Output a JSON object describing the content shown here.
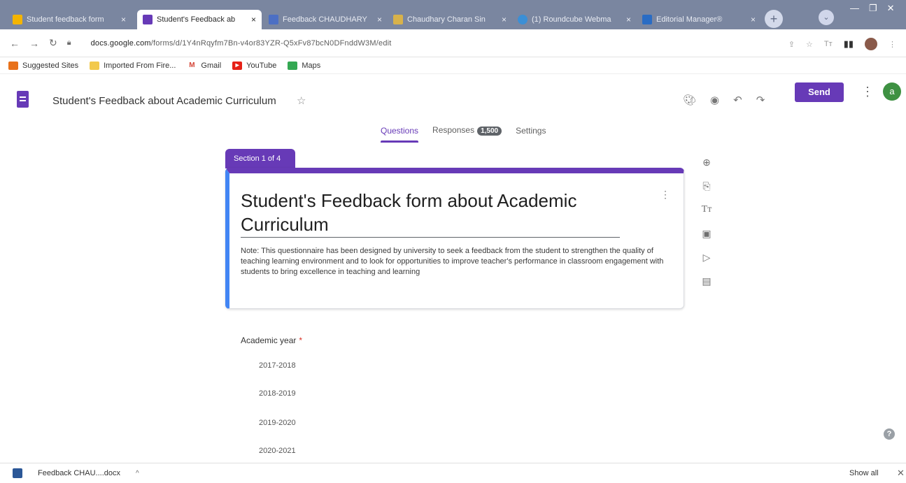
{
  "browser": {
    "tabs": [
      {
        "label": "Student feedback form",
        "active": false,
        "icon": "drive-icon",
        "color": "#f4b400"
      },
      {
        "label": "Student's Feedback ab",
        "active": true,
        "icon": "forms-icon",
        "color": "#673ab7"
      },
      {
        "label": "Feedback CHAUDHARY",
        "active": false,
        "icon": "forms-icon",
        "color": "#4c6fc4"
      },
      {
        "label": "Chaudhary Charan Sin",
        "active": false,
        "icon": "university-icon",
        "color": "#d8b24a"
      },
      {
        "label": "(1) Roundcube Webma",
        "active": false,
        "icon": "roundcube-icon",
        "color": "#3b8fd6"
      },
      {
        "label": "Editorial Manager®",
        "active": false,
        "icon": "editorial-icon",
        "color": "#2a6cc4"
      }
    ],
    "tab_close": "×",
    "new_tab": "+",
    "url_host": "docs.google.com",
    "url_path": "/forms/d/1Y4nRqyfm7Bn-v4or83YZR-Q5xFv87bcN0DFnddW3M/edit",
    "bookmarks": [
      {
        "label": "Suggested Sites",
        "icon": "bookmark-icon",
        "color": "#e8711a"
      },
      {
        "label": "Imported From Fire...",
        "icon": "folder-icon",
        "color": "#f2c94c"
      },
      {
        "label": "Gmail",
        "icon": "gmail-icon",
        "color": "#d44638"
      },
      {
        "label": "YouTube",
        "icon": "youtube-icon",
        "color": "#e62117"
      },
      {
        "label": "Maps",
        "icon": "maps-icon",
        "color": "#34a853"
      }
    ]
  },
  "forms_header": {
    "title": "Student's Feedback about Academic Curriculum",
    "send_label": "Send",
    "avatar_letter": "a",
    "accent": "#673ab7"
  },
  "form_tabs": {
    "questions": "Questions",
    "responses": "Responses",
    "responses_count": "1,500",
    "settings": "Settings"
  },
  "section": {
    "label": "Section 1 of 4",
    "title": "Student's Feedback form about Academic Curriculum",
    "note": "Note: This questionnaire has been designed by university to seek a feedback from the student to strengthen the quality of teaching learning environment and to look for opportunities to improve teacher's performance in classroom engagement with students to bring excellence in teaching and learning"
  },
  "question": {
    "label": "Academic year",
    "required_mark": "*",
    "options": [
      "2017-2018",
      "2018-2019",
      "2019-2020",
      "2020-2021"
    ]
  },
  "download_bar": {
    "file": "Feedback CHAU....docx",
    "show_all": "Show all"
  }
}
